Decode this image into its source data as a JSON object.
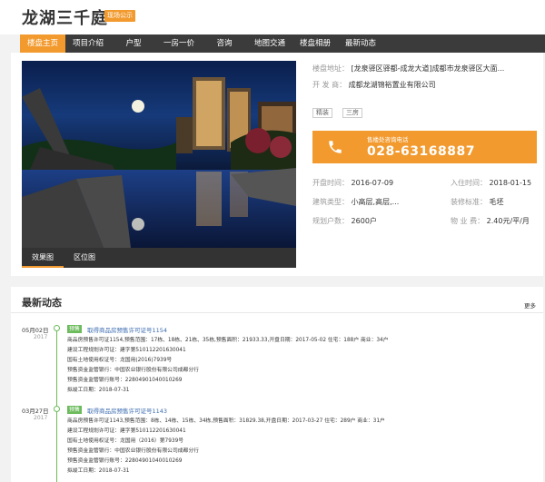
{
  "header": {
    "title": "龙湖三千庭",
    "badge": "现场公示"
  },
  "nav": {
    "items": [
      "楼盘主页",
      "项目介绍",
      "户型",
      "一房一价",
      "咨询",
      "地图交通",
      "楼盘相册",
      "最新动态"
    ]
  },
  "gallery": {
    "tabs": [
      "效果图",
      "区位图"
    ]
  },
  "info": {
    "address_label": "楼盘地址：",
    "address_value": "[龙泉驿区驿都-成龙大道]成都市龙泉驿区大面...",
    "developer_label": "开 发 商：",
    "developer_value": "成都龙湖锦裕置业有限公司",
    "tags": [
      "精装",
      "三房"
    ],
    "phone_hint": "售楼处咨询电话",
    "phone_number": "028-63168887",
    "open_label": "开盘时间：",
    "open_value": "2016-07-09",
    "move_label": "入住时间：",
    "move_value": "2018-01-15",
    "type_label": "建筑类型：",
    "type_value": "小高层,高层,...",
    "decor_label": "装修标准：",
    "decor_value": "毛坯",
    "households_label": "规划户数：",
    "households_value": "2600户",
    "fee_label": "物 业 费：",
    "fee_value": "2.40元/平/月"
  },
  "news": {
    "title": "最新动态",
    "more": "更多",
    "items": [
      {
        "date": "05月02日",
        "year": "2017",
        "tag": "预售",
        "headline": "取得商品房预售许可证号1154",
        "lines": [
          "商品房预售许可证1154,预售范围：17栋、18栋、21栋、35栋,预售面积：21933.33,开盘日期：2017-05-02  住宅：188户  商业：34户",
          "建设工程规划许可证：建字第510112201630041",
          "国有土地使用权证号：龙国用(2016)7939号",
          "预售资金监管银行：中国农业银行股份有限公司成都分行",
          "预售资金监管银行账号：22804901040010269",
          "拟竣工日期：2018-07-31"
        ]
      },
      {
        "date": "03月27日",
        "year": "2017",
        "tag": "预售",
        "headline": "取得商品房预售许可证号1143",
        "lines": [
          "商品房预售许可证1143,预售范围：8栋、14栋、15栋、34栋,预售面积：31829.38,开盘日期：2017-03-27  住宅：289户  商业：31户",
          "建设工程规划许可证：建字第510112201630041",
          "国有土地使用权证号：龙国用（2016）第7939号",
          "预售资金监管银行：中国农业银行股份有限公司成都分行",
          "预售资金监管银行账号：22804901040010269",
          "拟竣工日期：2018-07-31"
        ]
      }
    ]
  },
  "colors": {
    "accent": "#f29a2e",
    "nav_bg": "#3b3b3b",
    "timeline": "#6cbb5c",
    "link": "#3a6bb0"
  },
  "icons": {
    "phone": "phone-icon"
  }
}
